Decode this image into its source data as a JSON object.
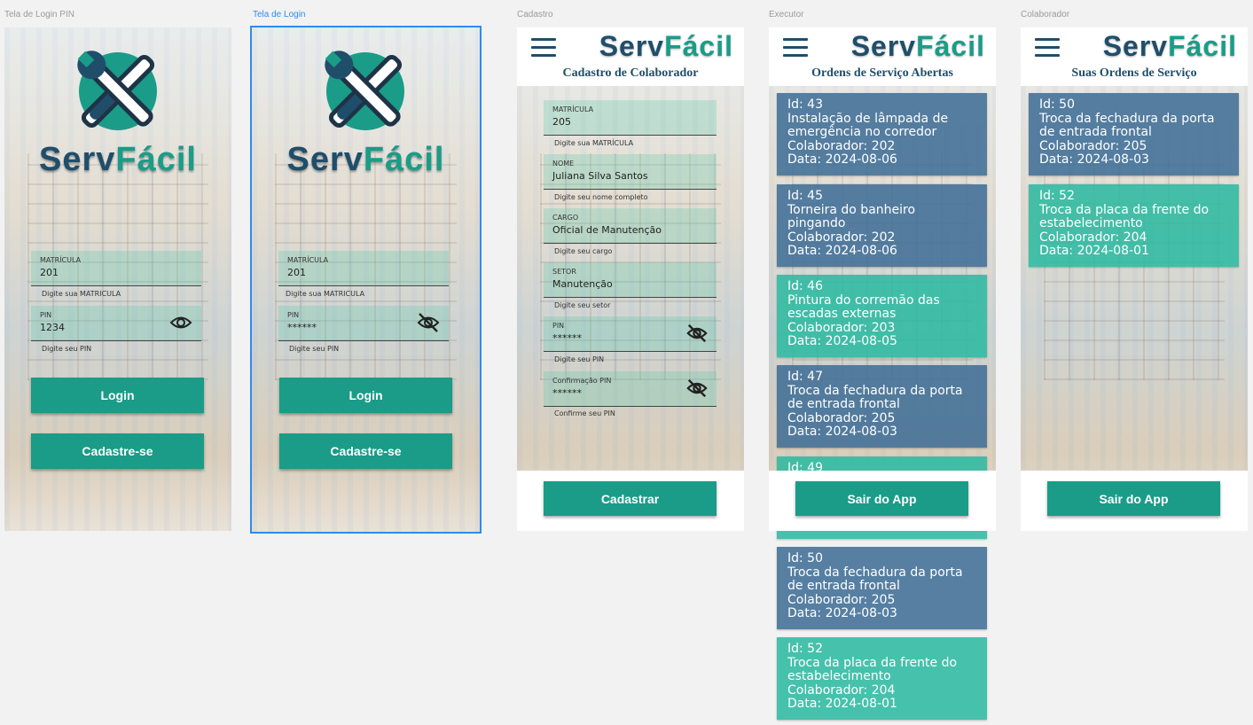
{
  "frames": {
    "login_pin": {
      "label": "Tela de Login PIN"
    },
    "login": {
      "label": "Tela de Login"
    },
    "cadastro": {
      "label": "Cadastro"
    },
    "executor": {
      "label": "Executor"
    },
    "colaborador": {
      "label": "Colaborador"
    }
  },
  "brand": {
    "part1": "Serv",
    "part2": "Fácil"
  },
  "colors": {
    "primary": "#1a9c88",
    "dark": "#1f4e6b",
    "card_blue": "#406e96",
    "card_teal": "#28b9a0",
    "selection": "#2d8cf0"
  },
  "login_pin": {
    "matricula_label": "MATRÍCULA",
    "matricula_value": "201",
    "matricula_hint": "Digite sua MATRICULA",
    "pin_label": "PIN",
    "pin_value": "1234",
    "pin_hint": "Digite seu PIN",
    "pin_icon": "eye-icon",
    "login_button": "Login",
    "signup_button": "Cadastre-se"
  },
  "login": {
    "matricula_label": "MATRÍCULA",
    "matricula_value": "201",
    "matricula_hint": "Digite sua MATRICULA",
    "pin_label": "PIN",
    "pin_value": "******",
    "pin_hint": "Digite seu PIN",
    "pin_icon": "eye-off-icon",
    "login_button": "Login",
    "signup_button": "Cadastre-se"
  },
  "cadastro": {
    "title": "Cadastro de Colaborador",
    "fields": [
      {
        "label": "MATRÍCULA",
        "value": "205",
        "hint": "Digite sua MATRÍCULA"
      },
      {
        "label": "NOME",
        "value": "Juliana Silva Santos",
        "hint": "Digite seu nome completo"
      },
      {
        "label": "CARGO",
        "value": "Oficial de Manutenção",
        "hint": "Digite seu cargo"
      },
      {
        "label": "SETOR",
        "value": "Manutenção",
        "hint": "Digite seu setor"
      },
      {
        "label": "PIN",
        "value": "******",
        "hint": "Digite seu PIN"
      },
      {
        "label": "Confirmação PIN",
        "value": "******",
        "hint": "Confirme seu PIN"
      }
    ],
    "submit_button": "Cadastrar"
  },
  "executor": {
    "title": "Ordens de Serviço Abertas",
    "exit_button": "Sair do App",
    "cards": [
      {
        "id": "Id: 43",
        "desc": "Instalação de lâmpada de emergência no corredor",
        "colab": "Colaborador: 202",
        "date": "Data: 2024-08-06"
      },
      {
        "id": "Id: 45",
        "desc": "Torneira do banheiro pingando",
        "colab": "Colaborador: 202",
        "date": "Data: 2024-08-06"
      },
      {
        "id": "Id: 46",
        "desc": "Pintura do corremão das escadas externas",
        "colab": "Colaborador: 203",
        "date": "Data: 2024-08-05"
      },
      {
        "id": "Id: 47",
        "desc": "Troca da fechadura da porta de entrada frontal",
        "colab": "Colaborador: 205",
        "date": "Data: 2024-08-03"
      },
      {
        "id": "Id: 49",
        "desc": "",
        "colab": "",
        "date": ""
      },
      {
        "id": "Id: 50",
        "desc": "Troca da fechadura da porta de entrada frontal",
        "colab": "Colaborador: 205",
        "date": "Data: 2024-08-03"
      },
      {
        "id": "Id: 52",
        "desc": "Troca da placa da frente do estabelecimento",
        "colab": "Colaborador: 204",
        "date": "Data: 2024-08-01"
      }
    ]
  },
  "colaborador": {
    "title": "Suas Ordens de Serviço",
    "exit_button": "Sair do App",
    "cards": [
      {
        "id": "Id: 50",
        "desc": "Troca da fechadura da porta de entrada frontal",
        "colab": "Colaborador: 205",
        "date": "Data: 2024-08-03"
      },
      {
        "id": "Id: 52",
        "desc": "Troca da placa da frente do estabelecimento",
        "colab": "Colaborador: 204",
        "date": "Data: 2024-08-01"
      }
    ]
  }
}
